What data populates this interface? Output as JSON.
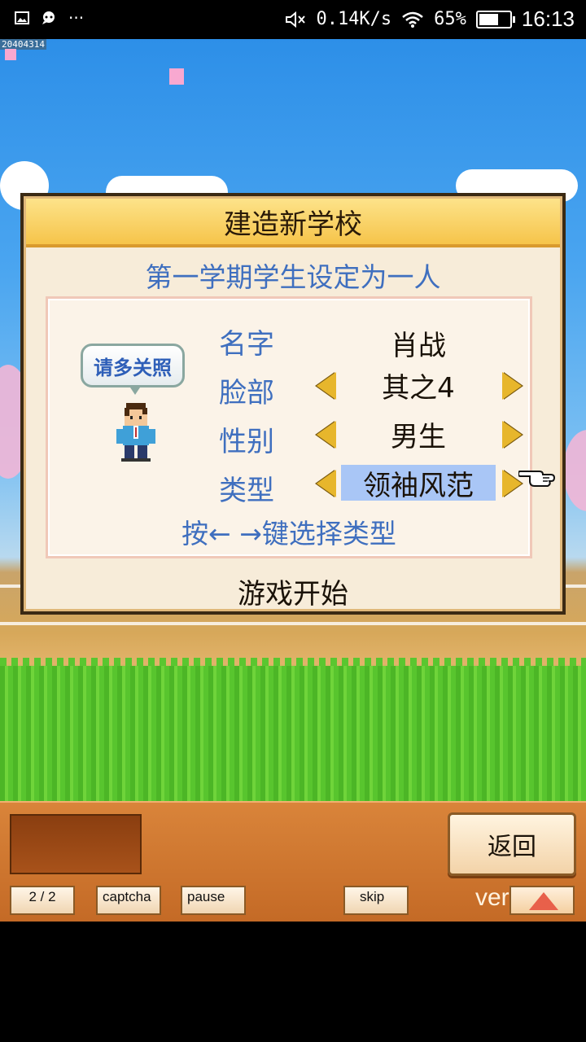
{
  "statusbar": {
    "network_speed": "0.14K/s",
    "battery_percent": "65%",
    "battery_level": 0.65,
    "time": "16:13",
    "left_icons": [
      "image-icon",
      "chat-icon",
      "more-dots-icon"
    ],
    "right_icons": [
      "mute-icon",
      "wifi-icon",
      "battery-icon"
    ]
  },
  "scene": {
    "build_code": "20404314"
  },
  "dialog": {
    "title": "建造新学校",
    "subtitle": "第一学期学生设定为一人",
    "bubble_text": "请多关照",
    "rows": [
      {
        "label": "名字",
        "value": "肖战"
      },
      {
        "label": "脸部",
        "value": "其之4"
      },
      {
        "label": "性别",
        "value": "男生"
      },
      {
        "label": "类型",
        "value": "领袖风范"
      }
    ],
    "hint": "按← →键选择类型",
    "start_label": "游戏开始"
  },
  "toolbar": {
    "back_label": "返回",
    "page_label": "2 / 2",
    "captcha_label": "captcha",
    "pause_label": "pause",
    "skip_label": "skip",
    "version_label": "ver 4."
  }
}
